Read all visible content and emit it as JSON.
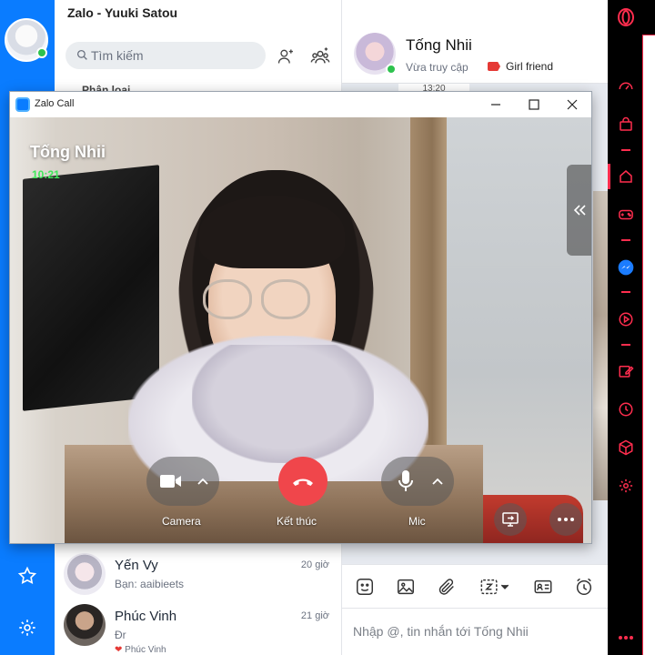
{
  "app": {
    "title": "Zalo - Yuuki Satou"
  },
  "search": {
    "placeholder": "Tìm kiếm"
  },
  "list": {
    "filter_label": "Phân loại",
    "conversations": [
      {
        "name": "Yến Vy",
        "subtitle": "Bạn: aaibieets",
        "time": "20 giờ"
      },
      {
        "name": "Phúc Vinh",
        "subtitle": "Đr",
        "subtitle2": "Phúc Vinh",
        "time": "21 giờ"
      }
    ]
  },
  "chat": {
    "contact_name": "Tống Nhii",
    "status": "Vừa truy cập",
    "tag": "Girl friend",
    "tag_color": "#e53935",
    "time_chip": "13:20",
    "input_placeholder": "Nhập @, tin nhắn tới Tống Nhii"
  },
  "call": {
    "window_title": "Zalo Call",
    "caller_name": "Tống Nhii",
    "timer": "10:21",
    "controls": {
      "camera_label": "Camera",
      "end_label": "Kết thúc",
      "mic_label": "Mic"
    },
    "end_color": "#f0464b"
  },
  "colors": {
    "zalo_blue": "#0a7cff",
    "opera_red": "#ff2d4e",
    "online_green": "#2ec24e"
  }
}
